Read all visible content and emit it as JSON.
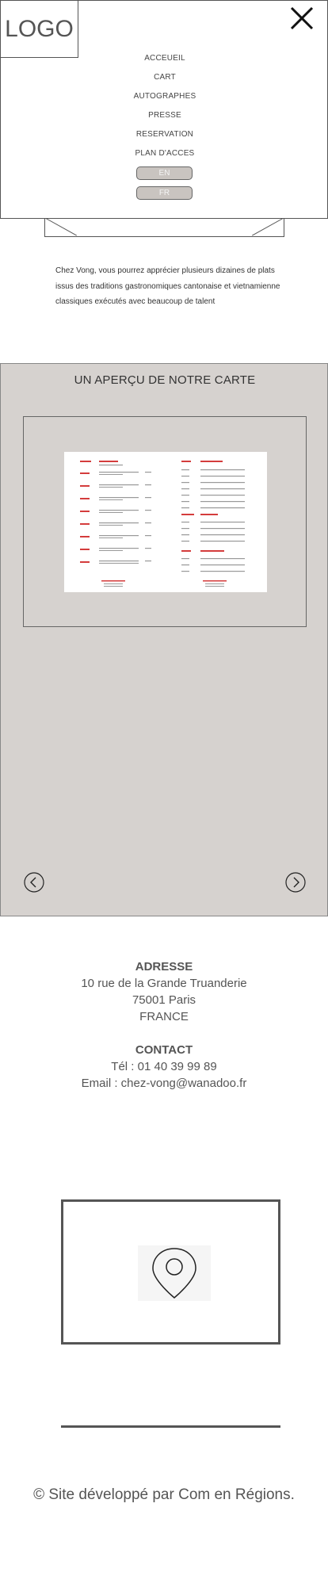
{
  "header": {
    "logo_text": "LOGO"
  },
  "nav": {
    "items": [
      "ACCEUEIL",
      "CART",
      "AUTOGRAPHES",
      "PRESSE",
      "RESERVATION",
      "PLAN D'ACCES"
    ],
    "lang_en": "EN",
    "lang_fr": "FR"
  },
  "intro": {
    "text": "Chez Vong, vous pourrez apprécier plusieurs dizaines de plats issus des traditions gastronomiques cantonaise et vietnamienne classiques exécutés avec beaucoup de talent"
  },
  "carte": {
    "title": "UN APERÇU DE NOTRE CARTE"
  },
  "contact": {
    "address_heading": "ADRESSE",
    "address_line1": "10 rue de la Grande Truanderie",
    "address_line2": "75001 Paris",
    "address_line3": "FRANCE",
    "contact_heading": "CONTACT",
    "phone": "Tél : 01 40 39 99 89",
    "email": "Email : chez-vong@wanadoo.fr"
  },
  "footer": {
    "text": "© Site développé par Com en Régions."
  },
  "icons": {
    "close": "close-icon",
    "prev": "chevron-left-icon",
    "next": "chevron-right-icon",
    "map": "map-pin-icon"
  },
  "colors": {
    "carte_bg": "#d6d2cf",
    "lang_button_bg": "#c9c4c0",
    "menu_accent_red": "#d43c3c"
  }
}
